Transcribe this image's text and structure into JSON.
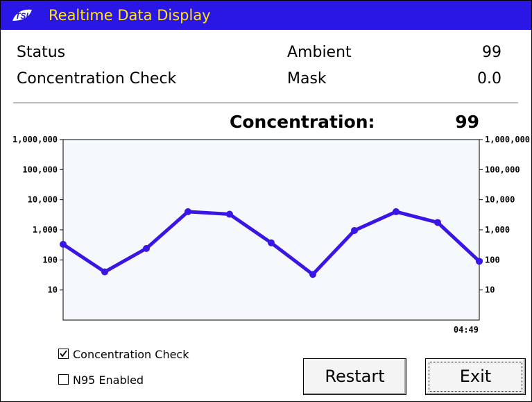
{
  "window": {
    "title": "Realtime Data Display",
    "logo_text": "TSI",
    "title_color": "#ffe21c",
    "titlebar_color": "#2a17e6"
  },
  "status": {
    "rows": [
      {
        "label": "Status",
        "mid_label": "Ambient",
        "value": "99"
      },
      {
        "label": "Concentration Check",
        "mid_label": "Mask",
        "value": "0.0"
      }
    ]
  },
  "concentration": {
    "label": "Concentration:",
    "value": "99"
  },
  "chart_data": {
    "type": "line",
    "y_scale": "log",
    "ylim": [
      1,
      1000000
    ],
    "y_ticks": [
      10,
      100,
      1000,
      10000,
      100000,
      1000000
    ],
    "y_tick_labels": [
      "10",
      "100",
      "1,000",
      "10,000",
      "100,000",
      "1,000,000"
    ],
    "x_tick_labels": [
      "04:49"
    ],
    "series_color": "#3b14e6",
    "series": [
      {
        "values": [
          330,
          40,
          240,
          4000,
          3300,
          370,
          33,
          950,
          4000,
          1750,
          90
        ]
      }
    ]
  },
  "options": {
    "concentration_check": {
      "label": "Concentration Check",
      "checked": true
    },
    "n95_enabled": {
      "label": "N95 Enabled",
      "checked": false
    }
  },
  "buttons": {
    "restart": "Restart",
    "exit": "Exit"
  }
}
